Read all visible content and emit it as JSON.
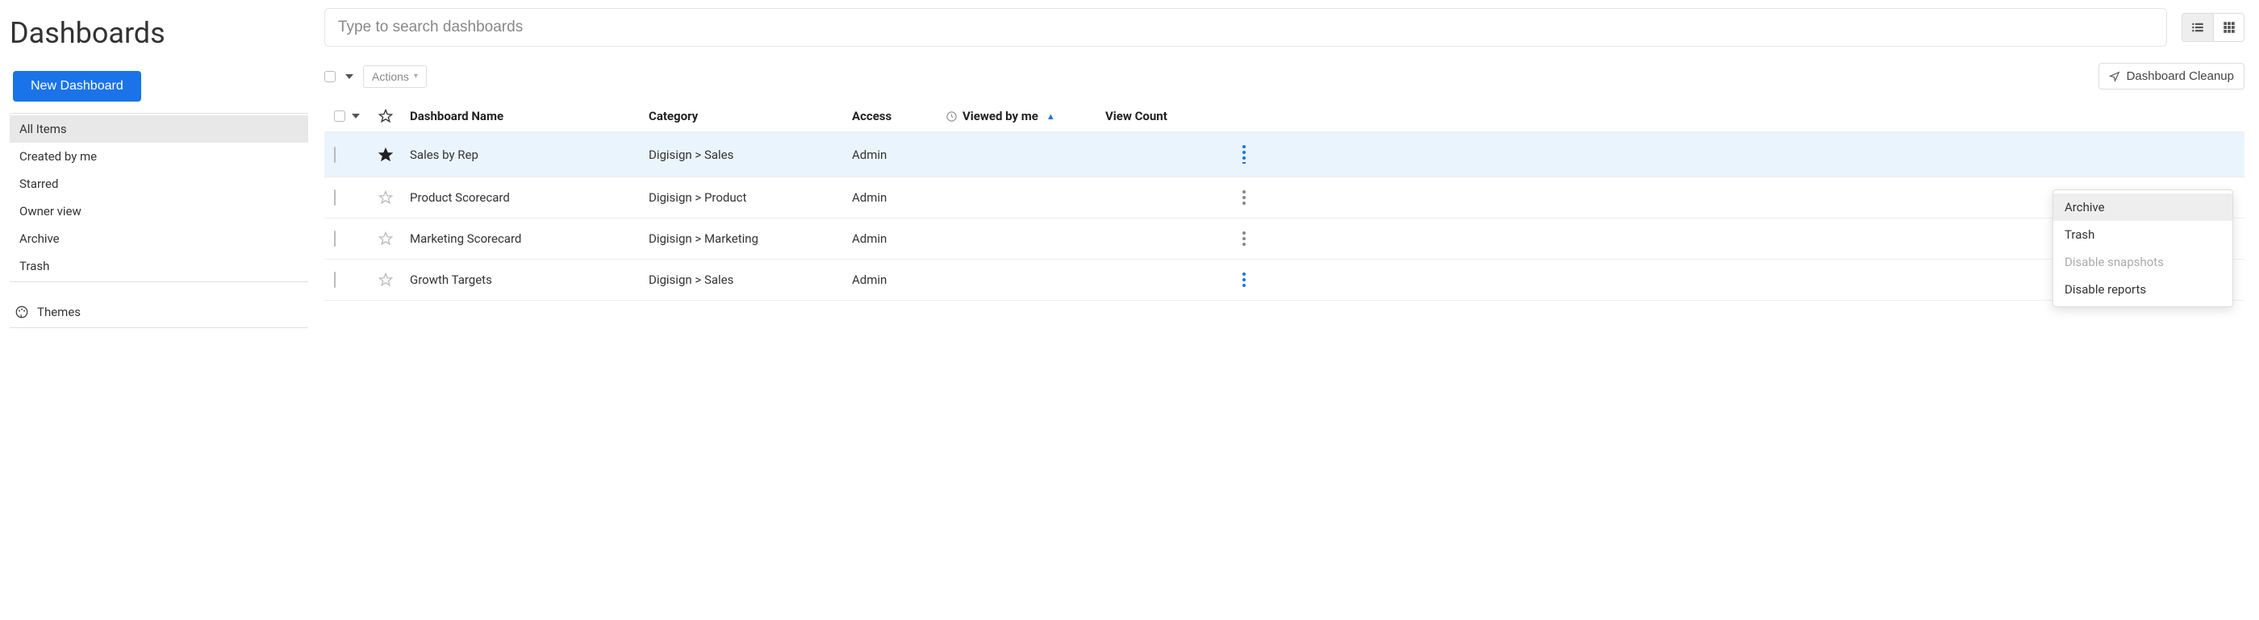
{
  "page_title": "Dashboards",
  "new_button": "New Dashboard",
  "sidebar": {
    "items": [
      {
        "label": "All Items",
        "active": true
      },
      {
        "label": "Created by me",
        "active": false
      },
      {
        "label": "Starred",
        "active": false
      },
      {
        "label": "Owner view",
        "active": false
      },
      {
        "label": "Archive",
        "active": false
      },
      {
        "label": "Trash",
        "active": false
      }
    ],
    "themes_label": "Themes"
  },
  "search": {
    "placeholder": "Type to search dashboards",
    "value": ""
  },
  "actions_button": "Actions",
  "cleanup_button": "Dashboard Cleanup",
  "columns": {
    "name": "Dashboard Name",
    "category": "Category",
    "access": "Access",
    "viewed": "Viewed by me",
    "view_count": "View Count"
  },
  "rows": [
    {
      "name": "Sales by Rep",
      "category": "Digisign > Sales",
      "access": "Admin",
      "starred": true,
      "highlight": true,
      "more_open": true
    },
    {
      "name": "Product Scorecard",
      "category": "Digisign > Product",
      "access": "Admin",
      "starred": false,
      "highlight": false,
      "more_open": false
    },
    {
      "name": "Marketing Scorecard",
      "category": "Digisign > Marketing",
      "access": "Admin",
      "starred": false,
      "highlight": false,
      "more_open": false
    },
    {
      "name": "Growth Targets",
      "category": "Digisign > Sales",
      "access": "Admin",
      "starred": false,
      "highlight": false,
      "more_open": false
    }
  ],
  "context_menu": [
    {
      "label": "Archive",
      "state": "hover"
    },
    {
      "label": "Trash",
      "state": "normal"
    },
    {
      "label": "Disable snapshots",
      "state": "disabled"
    },
    {
      "label": "Disable reports",
      "state": "normal"
    }
  ]
}
